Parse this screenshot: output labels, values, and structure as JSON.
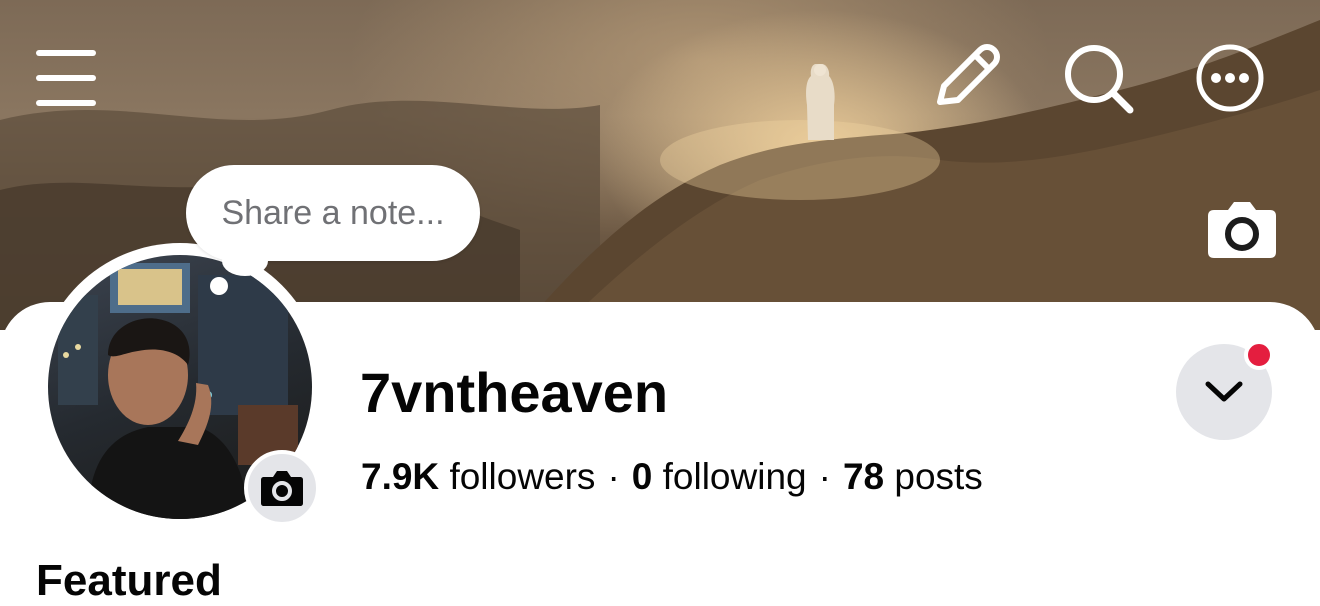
{
  "profile": {
    "username": "7vntheaven",
    "followers_count": "7.9K",
    "followers_label": "followers",
    "following_count": "0",
    "following_label": "following",
    "posts_count": "78",
    "posts_label": "posts",
    "separator": "·"
  },
  "note": {
    "placeholder": "Share a note..."
  },
  "icons": {
    "menu": "hamburger-menu-icon",
    "edit": "pencil-icon",
    "search": "search-icon",
    "more": "more-options-icon",
    "cover_camera": "camera-icon",
    "avatar_camera": "camera-icon",
    "expand": "chevron-down-icon"
  },
  "colors": {
    "notification_badge": "#e41e3f",
    "button_gray": "#e4e5e9",
    "text": "#050505",
    "placeholder_text": "#707175"
  },
  "below_fold_text": "Featured"
}
